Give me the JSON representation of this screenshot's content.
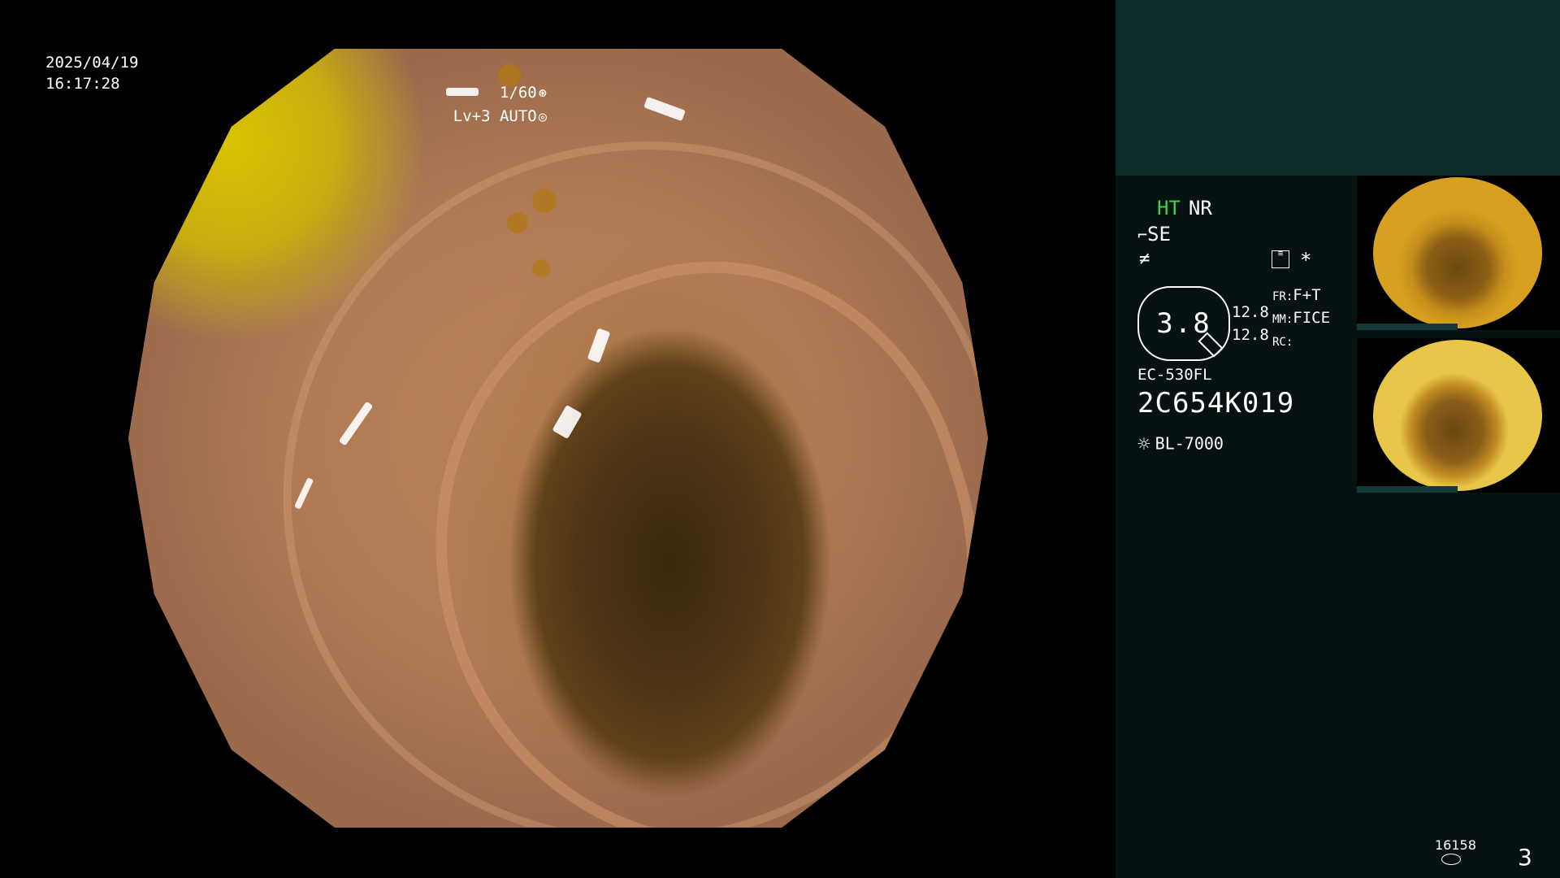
{
  "overlay": {
    "date": "2025/04/19",
    "time": "16:17:28",
    "shutter": "1/60",
    "level": "Lv+3",
    "mode": "AUTO"
  },
  "panel": {
    "ht": "HT",
    "nr": "NR",
    "se": "SE",
    "zoom": "3.8",
    "val1": "12.8",
    "val2": "12.8",
    "fr_label": "FR:",
    "fr_value": "F+T",
    "mm_label": "MM:",
    "mm_value": "FICE",
    "rc_label": "RC:",
    "scope_model": "EC-530FL",
    "serial": "2C654K019",
    "light_source": "BL-7000",
    "counter": "16158",
    "page": "3"
  },
  "colors": {
    "ht_green": "#3ed246",
    "panel_bg": "#071212",
    "panel_top": "#0e2a2b"
  },
  "icons": [
    "shutter-icon",
    "aperture-icon",
    "scope-icon",
    "freeze-icon",
    "menu-icon",
    "star-icon",
    "light-icon",
    "disk-icon"
  ]
}
